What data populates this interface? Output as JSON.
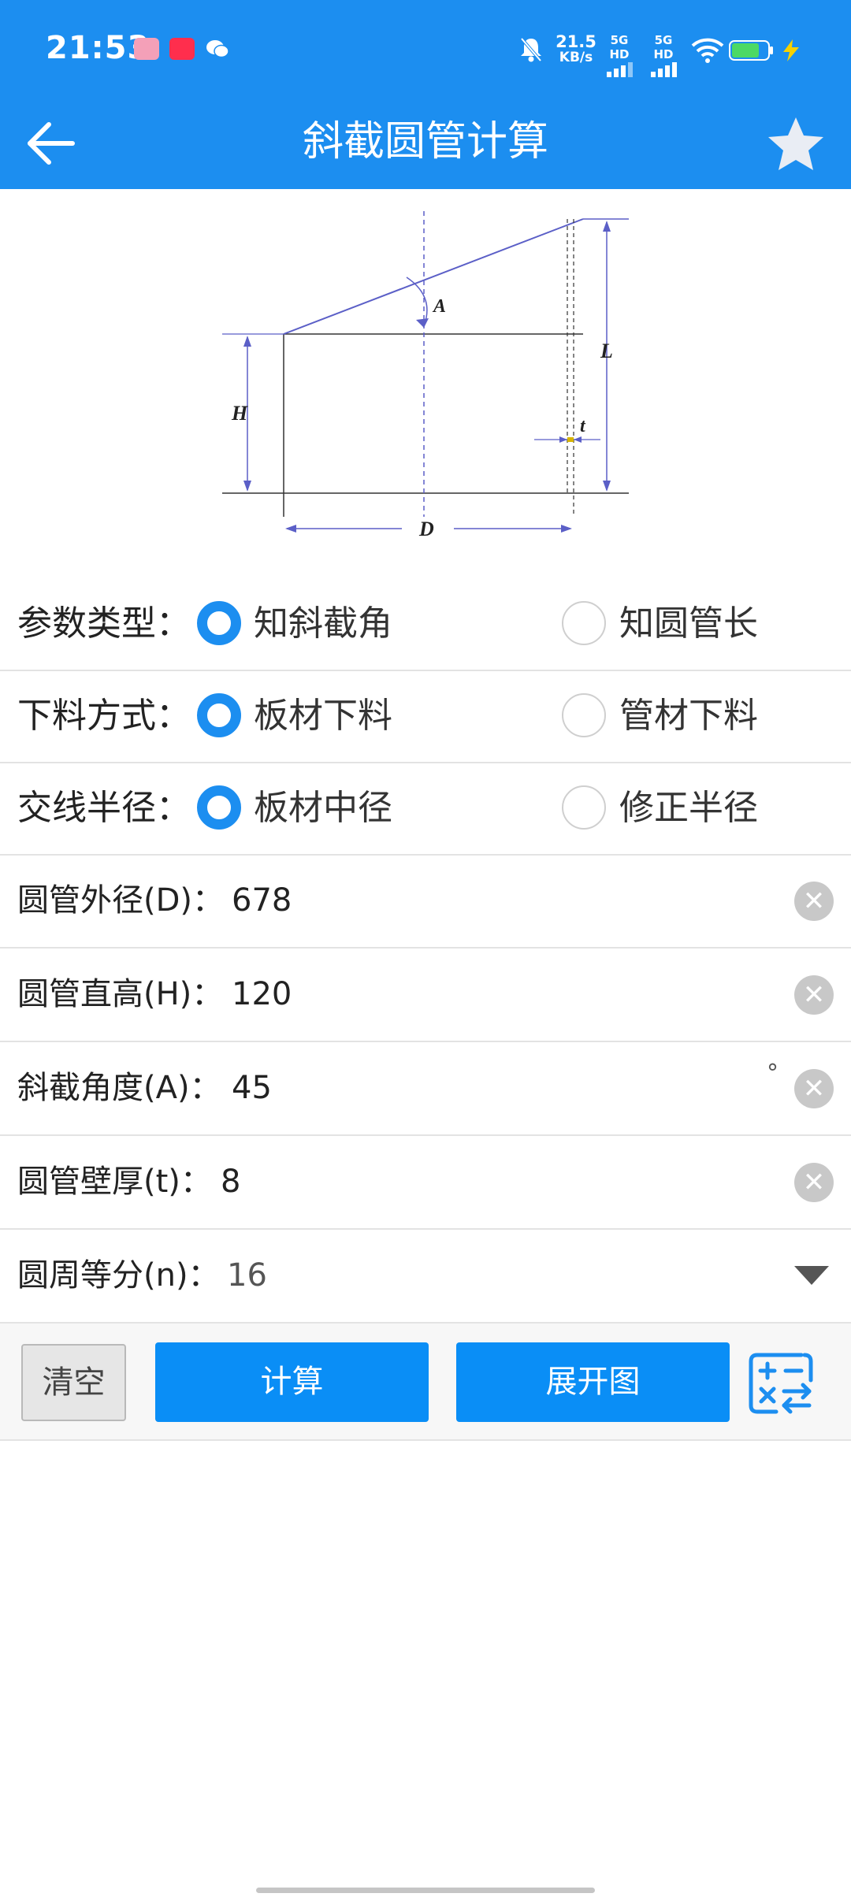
{
  "status_bar": {
    "time": "21:53",
    "net_speed_value": "21.5",
    "net_speed_unit": "KB/s",
    "signal1": "5G HD",
    "signal2": "5G HD",
    "icons": [
      "bilibili-app-icon",
      "xiaohongshu-app-icon",
      "wechat-icon",
      "mute-bell-icon",
      "signal-icon",
      "signal-icon",
      "wifi-icon",
      "battery-icon",
      "charging-icon"
    ]
  },
  "header": {
    "title": "斜截圆管计算",
    "back_icon": "arrow-left-icon",
    "favorite_icon": "star-icon"
  },
  "diagram": {
    "labels": {
      "angle": "A",
      "height": "H",
      "length": "L",
      "thickness": "t",
      "diameter": "D"
    }
  },
  "options": [
    {
      "label": "参数类型：",
      "choices": [
        "知斜截角",
        "知圆管长"
      ],
      "selected": 0
    },
    {
      "label": "下料方式：",
      "choices": [
        "板材下料",
        "管材下料"
      ],
      "selected": 0
    },
    {
      "label": "交线半径：",
      "choices": [
        "板材中径",
        "修正半径"
      ],
      "selected": 0
    }
  ],
  "inputs": [
    {
      "label": "圆管外径(D)：",
      "value": "678"
    },
    {
      "label": "圆管直高(H)：",
      "value": "120"
    },
    {
      "label": "斜截角度(A)：",
      "value": "45",
      "unit": "°"
    },
    {
      "label": "圆管壁厚(t)：",
      "value": "8"
    }
  ],
  "select": {
    "label": "圆周等分(n)：",
    "value": "16"
  },
  "actions": {
    "clear_label": "清空",
    "calculate_label": "计算",
    "unfold_label": "展开图",
    "calculator_icon": "calculator-icon"
  },
  "colors": {
    "primary": "#1c8ef0",
    "button": "#0a8ef6",
    "diagram_line": "#5b5fc7"
  }
}
